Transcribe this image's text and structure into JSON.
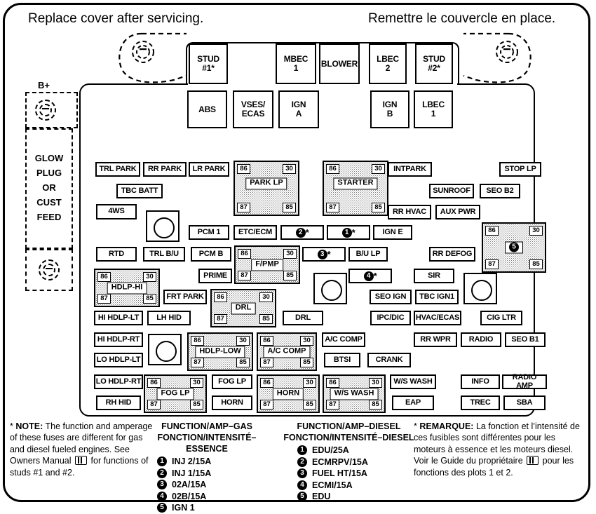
{
  "headers": {
    "english": "Replace cover after servicing.",
    "french": "Remettre le couvercle en place."
  },
  "left_terminal": {
    "bplus_label": "B+",
    "lines": [
      "GLOW",
      "PLUG",
      "OR",
      "CUST",
      "FEED"
    ]
  },
  "top_row": [
    {
      "label": "STUD\n#1*"
    },
    {
      "label": "MBEC\n1"
    },
    {
      "label": "BLOWER"
    },
    {
      "label": "LBEC\n2"
    },
    {
      "label": "STUD\n#2*"
    }
  ],
  "second_row": [
    {
      "label": "ABS"
    },
    {
      "label": "VSES/\nECAS"
    },
    {
      "label": "IGN\nA"
    },
    {
      "label": "IGN\nB"
    },
    {
      "label": "LBEC\n1"
    }
  ],
  "fuses": [
    {
      "id": "trl-park",
      "label": "TRL PARK"
    },
    {
      "id": "rr-park",
      "label": "RR PARK"
    },
    {
      "id": "lr-park",
      "label": "LR PARK"
    },
    {
      "id": "intpark",
      "label": "INTPARK"
    },
    {
      "id": "stop-lp",
      "label": "STOP LP"
    },
    {
      "id": "tbc-batt",
      "label": "TBC BATT"
    },
    {
      "id": "sunroof",
      "label": "SUNROOF"
    },
    {
      "id": "seo-b2",
      "label": "SEO B2"
    },
    {
      "id": "4ws",
      "label": "4WS"
    },
    {
      "id": "rr-hvac",
      "label": "RR HVAC"
    },
    {
      "id": "aux-pwr",
      "label": "AUX PWR"
    },
    {
      "id": "pcm-1",
      "label": "PCM 1"
    },
    {
      "id": "etc-ecm",
      "label": "ETC/ECM"
    },
    {
      "id": "ign-e",
      "label": "IGN E"
    },
    {
      "id": "rtd",
      "label": "RTD"
    },
    {
      "id": "trl-bu",
      "label": "TRL B/U"
    },
    {
      "id": "pcm-b",
      "label": "PCM B"
    },
    {
      "id": "bu-lp",
      "label": "B/U LP"
    },
    {
      "id": "rr-defog",
      "label": "RR DEFOG"
    },
    {
      "id": "prime",
      "label": "PRIME"
    },
    {
      "id": "sir",
      "label": "SIR"
    },
    {
      "id": "frt-park",
      "label": "FRT PARK"
    },
    {
      "id": "seo-ign",
      "label": "SEO IGN"
    },
    {
      "id": "tbc-ign1",
      "label": "TBC IGN1"
    },
    {
      "id": "hi-hdlp-lt",
      "label": "HI HDLP-LT"
    },
    {
      "id": "lh-hid",
      "label": "LH HID"
    },
    {
      "id": "drl-fuse",
      "label": "DRL"
    },
    {
      "id": "ipc-dic",
      "label": "IPC/DIC"
    },
    {
      "id": "hvac-ecas",
      "label": "HVAC/ECAS"
    },
    {
      "id": "cig-ltr",
      "label": "CIG LTR"
    },
    {
      "id": "hi-hdlp-rt",
      "label": "HI HDLP-RT"
    },
    {
      "id": "ac-comp-f",
      "label": "A/C COMP"
    },
    {
      "id": "rr-wpr",
      "label": "RR WPR"
    },
    {
      "id": "radio",
      "label": "RADIO"
    },
    {
      "id": "seo-b1",
      "label": "SEO B1"
    },
    {
      "id": "lo-hdlp-lt",
      "label": "LO HDLP-LT"
    },
    {
      "id": "btsi",
      "label": "BTSI"
    },
    {
      "id": "crank",
      "label": "CRANK"
    },
    {
      "id": "lo-hdlp-rt",
      "label": "LO HDLP-RT"
    },
    {
      "id": "fog-lp-f",
      "label": "FOG LP"
    },
    {
      "id": "ws-wash-f",
      "label": "W/S WASH"
    },
    {
      "id": "info",
      "label": "INFO"
    },
    {
      "id": "radio-amp",
      "label": "RADIO AMP"
    },
    {
      "id": "rh-hid",
      "label": "RH HID"
    },
    {
      "id": "horn-f",
      "label": "HORN"
    },
    {
      "id": "eap",
      "label": "EAP"
    },
    {
      "id": "trec",
      "label": "TREC"
    },
    {
      "id": "sba",
      "label": "SBA"
    }
  ],
  "relays": [
    {
      "id": "park-lp",
      "label": "PARK LP",
      "pins": {
        "a": "86",
        "b": "30",
        "c": "87",
        "d": "85"
      }
    },
    {
      "id": "starter",
      "label": "STARTER",
      "pins": {
        "a": "86",
        "b": "30",
        "c": "87",
        "d": "85"
      }
    },
    {
      "id": "relay-5",
      "label": "5",
      "numbered": true,
      "pins": {
        "a": "86",
        "b": "30",
        "c": "87",
        "d": "85"
      }
    },
    {
      "id": "fpmp",
      "label": "F/PMP",
      "pins": {
        "a": "86",
        "b": "30",
        "c": "87",
        "d": "85"
      }
    },
    {
      "id": "hdlp-hi",
      "label": "HDLP-HI",
      "pins": {
        "a": "86",
        "b": "30",
        "c": "87",
        "d": "85"
      }
    },
    {
      "id": "drl",
      "label": "DRL",
      "pins": {
        "a": "86",
        "b": "30",
        "c": "87",
        "d": "85"
      }
    },
    {
      "id": "hdlp-low",
      "label": "HDLP-LOW",
      "pins": {
        "a": "86",
        "b": "30",
        "c": "87",
        "d": "85"
      }
    },
    {
      "id": "ac-comp",
      "label": "A/C COMP",
      "pins": {
        "a": "86",
        "b": "30",
        "c": "87",
        "d": "85"
      }
    },
    {
      "id": "fog-lp",
      "label": "FOG LP",
      "pins": {
        "a": "86",
        "b": "30",
        "c": "87",
        "d": "85"
      }
    },
    {
      "id": "horn",
      "label": "HORN",
      "pins": {
        "a": "86",
        "b": "30",
        "c": "87",
        "d": "85"
      }
    },
    {
      "id": "ws-wash",
      "label": "W/S WASH",
      "pins": {
        "a": "86",
        "b": "30",
        "c": "87",
        "d": "85"
      }
    }
  ],
  "numbered_fuses": [
    {
      "id": "num-2",
      "number": "2",
      "star": "*"
    },
    {
      "id": "num-1",
      "number": "1",
      "star": "*"
    },
    {
      "id": "num-3",
      "number": "3",
      "star": "*"
    },
    {
      "id": "num-4",
      "number": "4",
      "star": "*"
    }
  ],
  "note_en": {
    "star": "*",
    "label": "NOTE:",
    "text_1": "The function and amperage of these fuses are different for gas and diesel fueled engines.  See Owners Manual",
    "text_2": "for functions of studs #1 and #2."
  },
  "note_fr": {
    "star": "*",
    "label": "REMARQUE:",
    "text_1": "La fonction et l’intensité de ces fusibles sont différentes pour les moteurs à essence et les moteurs diesel. Voir le Guide du propriétaire",
    "text_2": "pour les fonctions des plots 1 et 2."
  },
  "gas_column": {
    "title_en": "FUNCTION/AMP–GAS",
    "title_fr": "FONCTION/INTENSITÉ–ESSENCE",
    "rows": [
      {
        "number": "1",
        "text": "INJ 2/15A"
      },
      {
        "number": "2",
        "text": "INJ 1/15A"
      },
      {
        "number": "3",
        "text": "02A/15A"
      },
      {
        "number": "4",
        "text": "02B/15A"
      },
      {
        "number": "5",
        "text": "IGN 1"
      }
    ]
  },
  "diesel_column": {
    "title_en": "FUNCTION/AMP–DIESEL",
    "title_fr": "FONCTION/INTENSITÉ–DIESEL",
    "rows": [
      {
        "number": "1",
        "text": "EDU/25A"
      },
      {
        "number": "2",
        "text": "ECMRPV/15A"
      },
      {
        "number": "3",
        "text": "FUEL HT/15A"
      },
      {
        "number": "4",
        "text": "ECMI/15A"
      },
      {
        "number": "5",
        "text": "EDU"
      }
    ]
  }
}
